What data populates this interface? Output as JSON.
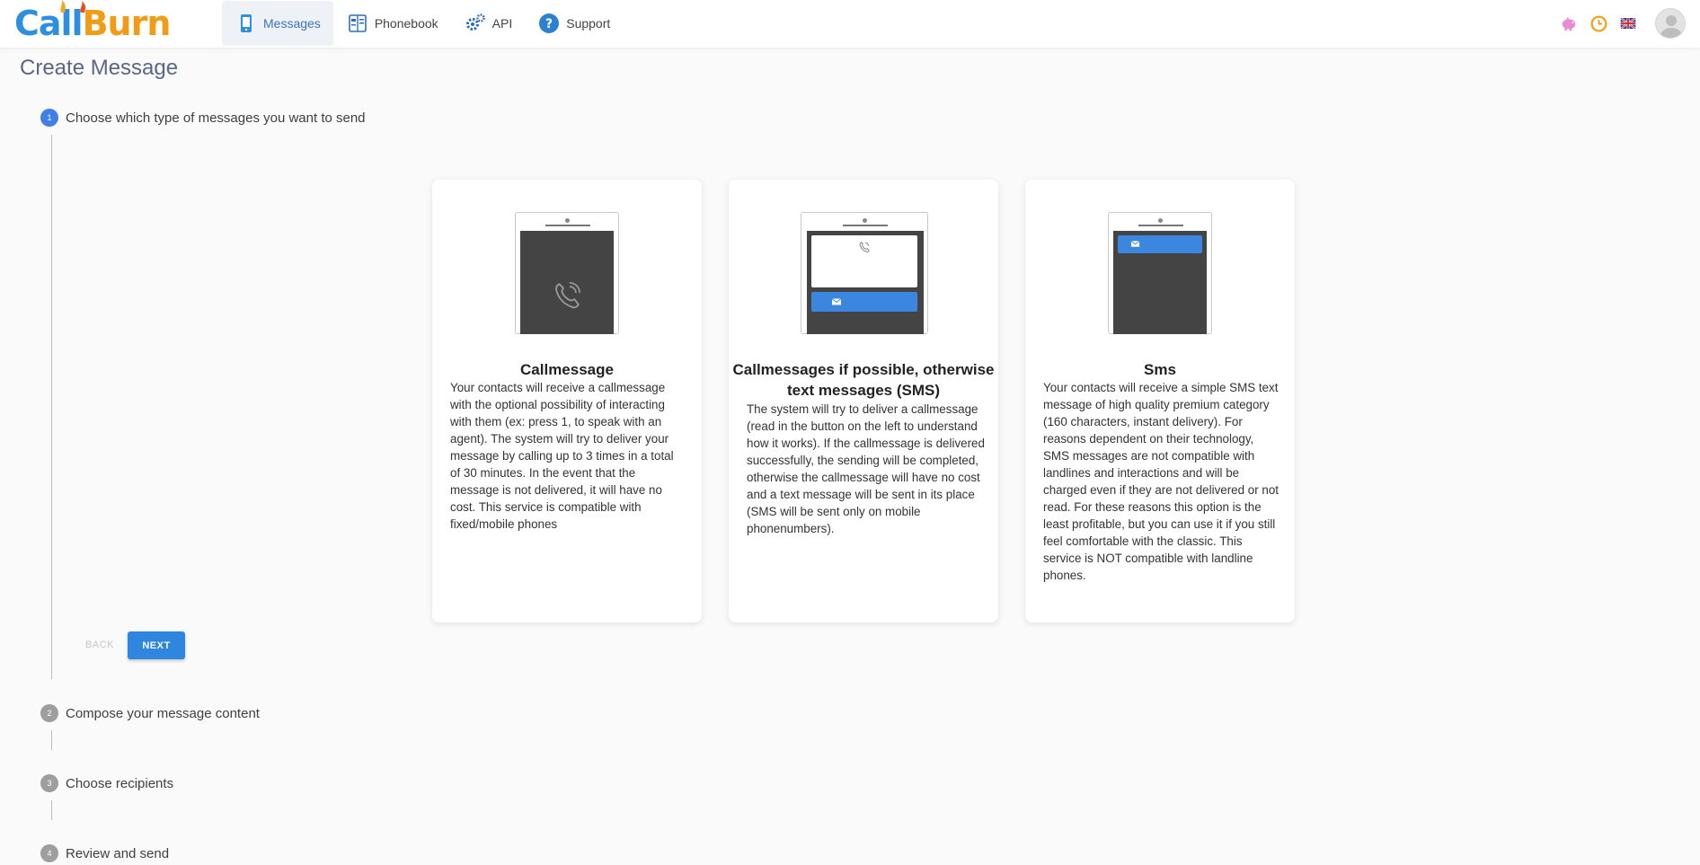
{
  "brand": {
    "logo_text_1": "Call",
    "logo_text_2": "Burn"
  },
  "nav": [
    {
      "label": "Messages",
      "icon": "phone-messages-icon",
      "active": true
    },
    {
      "label": "Phonebook",
      "icon": "phonebook-icon",
      "active": false
    },
    {
      "label": "API",
      "icon": "gears-icon",
      "active": false
    },
    {
      "label": "Support",
      "icon": "question-icon",
      "active": false
    }
  ],
  "header_icons": [
    "piggy-bank-icon",
    "clock-icon",
    "uk-flag-icon",
    "avatar"
  ],
  "page": {
    "title": "Create Message"
  },
  "steps": [
    {
      "number": "1",
      "label": "Choose which type of messages you want to send",
      "active": true
    },
    {
      "number": "2",
      "label": "Compose your message content",
      "active": false
    },
    {
      "number": "3",
      "label": "Choose recipients",
      "active": false
    },
    {
      "number": "4",
      "label": "Review and send",
      "active": false
    }
  ],
  "cards": [
    {
      "title": "Callmessage",
      "description": "Your contacts will receive a callmessage with the optional possibility of interacting with them (ex: press 1, to speak with an agent). The system will try to deliver your message by calling up to 3 times in a total of 30 minutes. In the event that the message is not delivered, it will have no cost. This service is compatible with fixed/mobile phones"
    },
    {
      "title": "Callmessages if possible, otherwise text messages (SMS)",
      "description": "The system will try to deliver a callmessage (read in the button on the left to understand how it works). If the callmessage is delivered successfully, the sending will be completed, otherwise the callmessage will have no cost and a text message will be sent in its place (SMS will be sent only on mobile phonenumbers)."
    },
    {
      "title": "Sms",
      "description": "Your contacts will receive a simple SMS text message of high quality premium category (160 characters, instant delivery). For reasons dependent on their technology, SMS messages are not compatible with landlines and interactions and will be charged even if they are not delivered or not read. For these reasons this option is the least profitable, but you can use it if you still feel comfortable with the classic. This service is NOT compatible with landline phones."
    }
  ],
  "actions": {
    "back_label": "BACK",
    "next_label": "NEXT"
  },
  "colors": {
    "accent": "#2f86de",
    "step_active": "#3f7fe6",
    "title": "#5a6784"
  }
}
